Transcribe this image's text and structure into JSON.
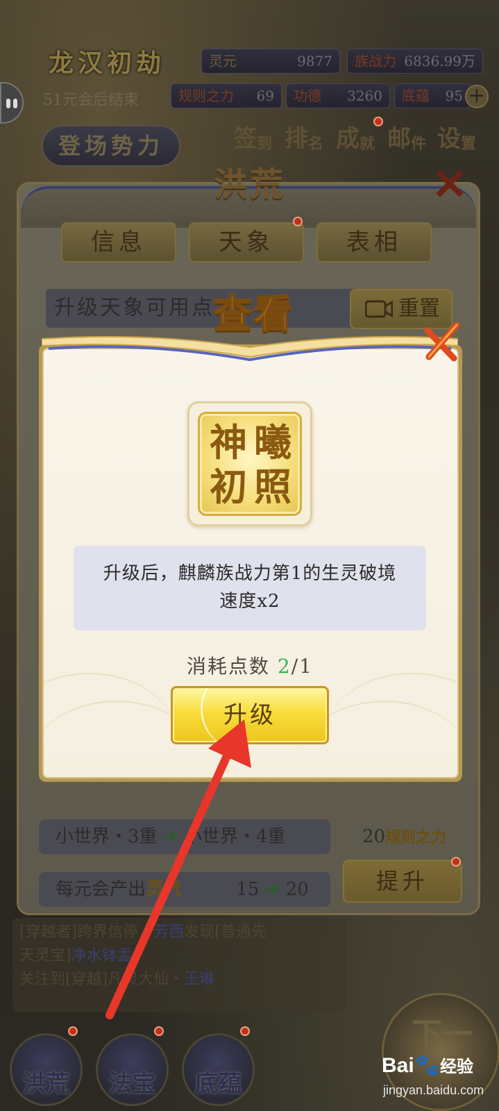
{
  "hud": {
    "game_title": "龙汉初劫",
    "lingyuan_label": "灵元",
    "lingyuan_value": "9877",
    "zhanli_label": "族战力",
    "zhanli_value": "6836.99万",
    "era_status": "51元会后结束",
    "guize_label": "规则之力",
    "guize_value": "69",
    "gongde_label": "功德",
    "gongde_value": "3260",
    "dianqi_label": "底蕴",
    "dianqi_value": "95",
    "entry_button": "登场势力",
    "top_nav": [
      {
        "main": "签",
        "sub": "到"
      },
      {
        "main": "排",
        "sub": "名"
      },
      {
        "main": "成",
        "sub": "就"
      },
      {
        "main": "邮",
        "sub": "件"
      },
      {
        "main": "设",
        "sub": "置"
      }
    ]
  },
  "outer_panel": {
    "title": "洪荒",
    "tabs": [
      "信息",
      "天象",
      "表相"
    ],
    "info_text": "升级天象可用点",
    "reset_label": "重置",
    "row1_from": "小世界・3重",
    "row1_to": "小世界・4重",
    "row2_label": "每元会产出",
    "row2_gold": "灵气",
    "row2_from": "15",
    "row2_to": "20",
    "cost_value": "20",
    "cost_label": "规则之力",
    "upgrade_label": "提升"
  },
  "background_feed": {
    "line1_a": "[穿越者]跨界信停・",
    "line1_name": "芳西",
    "line1_b": "发现[普通先",
    "line2_a": "天灵宝]",
    "line2_name": "净水钵盂",
    "line3_a": "关注到[穿越",
    "line3_b": "]凡灵大仙・",
    "line3_name": "王琳"
  },
  "bottom_tabs": [
    "洪荒",
    "法宝",
    "底蕴"
  ],
  "bottom_right": "下一",
  "modal": {
    "title": "查看",
    "skill_chars": [
      "神",
      "曦",
      "初",
      "照"
    ],
    "description": "升级后，麒麟族战力第1的生灵破境速度x2",
    "cost_label": "消耗点数",
    "cost_have": "2",
    "cost_sep_need": "/1",
    "upgrade_label": "升级"
  },
  "watermark": {
    "logo": "Bai",
    "logo_suffix": "经验",
    "url": "jingyan.baidu.com"
  },
  "colors": {
    "modal_bg": "#f9f5ea",
    "gold_button": "#f8dd3a",
    "have_points": "#31b24e",
    "arrow": "#e8362a",
    "title_gold": "#e5a92a"
  }
}
